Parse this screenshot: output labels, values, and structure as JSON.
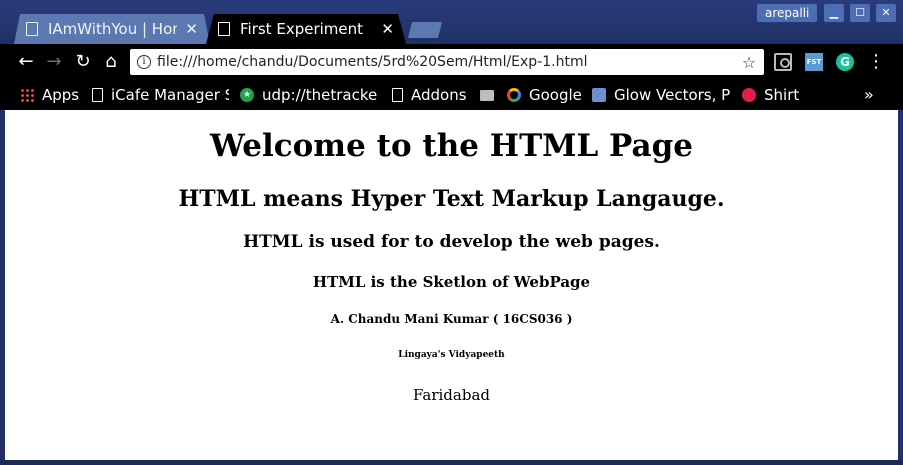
{
  "window": {
    "user": "arepalli",
    "min_symbol": "▁",
    "max_symbol": "☐",
    "close_symbol": "✕"
  },
  "tabs": [
    {
      "label": "IAmWithYou | Home",
      "active": false
    },
    {
      "label": "First Experiment",
      "active": true
    }
  ],
  "toolbar": {
    "back_symbol": "←",
    "forward_symbol": "→",
    "reload_symbol": "↻",
    "home_symbol": "⌂",
    "url": "file:///home/chandu/Documents/5rd%20Sem/Html/Exp-1.html",
    "info_symbol": "i",
    "star_symbol": "☆",
    "menu_symbol": "⋮",
    "fst_label": "FST",
    "grammarly_label": "G"
  },
  "bookmarks": [
    {
      "label": "Apps",
      "icon": "apps-grid-icon"
    },
    {
      "label": "iCafe Manager Se",
      "icon": "page-icon"
    },
    {
      "label": "udp://thetracker",
      "icon": "star-badge-icon"
    },
    {
      "label": "Addons",
      "icon": "page-icon"
    },
    {
      "label": "",
      "icon": "folder-icon"
    },
    {
      "label": "Google",
      "icon": "google-icon"
    },
    {
      "label": "Glow Vectors, Ph",
      "icon": "glow-icon"
    },
    {
      "label": "Shirt",
      "icon": "shirt-icon"
    }
  ],
  "bookmarks_more": "»",
  "page": {
    "h1": "Welcome to the HTML Page",
    "h2": "HTML means Hyper Text Markup Langauge.",
    "h3": "HTML is used for to develop the web pages.",
    "h4": "HTML is the Sketlon of WebPage",
    "h5": "A. Chandu Mani Kumar ( 16CS036 )",
    "h6": "Lingaya's Vidyapeeth",
    "p": "Faridabad"
  },
  "colors": {
    "titlebar": "#22306a",
    "tab_inactive": "#5c78b0",
    "toolbar": "#000000",
    "page_bg": "#ffffff"
  }
}
